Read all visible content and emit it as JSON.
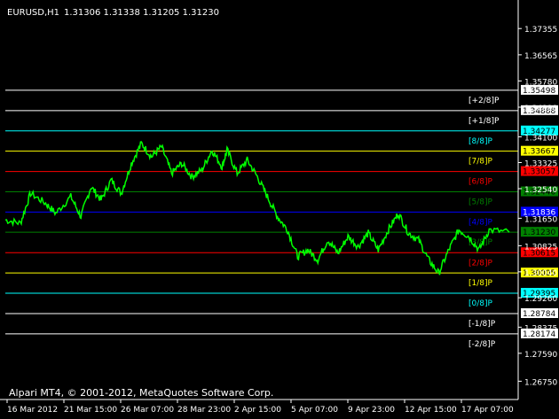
{
  "header": {
    "symbol_tf": "EURUSD,H1",
    "ohlc": "1.31306 1.31338 1.31205 1.31230"
  },
  "footer": {
    "copyright": "Alpari MT4, © 2001-2012, MetaQuotes Software Corp."
  },
  "colors": {
    "background": "#000000",
    "price_line": "#00ff00",
    "axis": "#ffffff"
  },
  "y_axis_labels": [
    "1.37355",
    "1.36565",
    "1.35780",
    "1.34990",
    "1.34100",
    "1.33325",
    "1.32540",
    "1.31650",
    "1.30825",
    "1.30040",
    "1.29260",
    "1.28375",
    "1.27590",
    "1.26750"
  ],
  "x_axis_labels": [
    "16 Mar 2012",
    "21 Mar 15:00",
    "26 Mar 07:00",
    "28 Mar 23:00",
    "2 Apr 15:00",
    "5 Apr 07:00",
    "9 Apr 23:00",
    "12 Apr 15:00",
    "17 Apr 07:00"
  ],
  "murrey_lines": [
    {
      "label": "[+2/8]P",
      "price": "1.35498",
      "color": "#ffffff",
      "tag_bg": "#ffffff",
      "tag_fg": "#000000"
    },
    {
      "label": "[+1/8]P",
      "price": "1.34888",
      "color": "#ffffff",
      "tag_bg": "#ffffff",
      "tag_fg": "#000000"
    },
    {
      "label": "[8/8]P",
      "price": "1.34277",
      "color": "#00ffff",
      "tag_bg": "#00ffff",
      "tag_fg": "#000000"
    },
    {
      "label": "[7/8]P",
      "price": "1.33667",
      "color": "#ffff00",
      "tag_bg": "#ffff00",
      "tag_fg": "#000000"
    },
    {
      "label": "[6/8]P",
      "price": "1.33057",
      "color": "#ff0000",
      "tag_bg": "#ff0000",
      "tag_fg": "#000000"
    },
    {
      "label": "[5/8]P",
      "price": "1.32446",
      "color": "#008000",
      "tag_bg": "#008000",
      "tag_fg": "#000000"
    },
    {
      "label": "[4/8]P",
      "price": "1.31836",
      "color": "#0000ff",
      "tag_bg": "#0000ff",
      "tag_fg": "#ffffff"
    },
    {
      "label": "[3/8]P",
      "price": "1.31230",
      "color": "#008000",
      "tag_bg": "#008000",
      "tag_fg": "#000000"
    },
    {
      "label": "[2/8]P",
      "price": "1.30615",
      "color": "#ff0000",
      "tag_bg": "#ff0000",
      "tag_fg": "#000000"
    },
    {
      "label": "[1/8]P",
      "price": "1.30005",
      "color": "#ffff00",
      "tag_bg": "#ffff00",
      "tag_fg": "#000000"
    },
    {
      "label": "[0/8]P",
      "price": "1.29395",
      "color": "#00ffff",
      "tag_bg": "#00ffff",
      "tag_fg": "#000000"
    },
    {
      "label": "[-1/8]P",
      "price": "1.28784",
      "color": "#ffffff",
      "tag_bg": "#ffffff",
      "tag_fg": "#000000"
    },
    {
      "label": "[-2/8]P",
      "price": "1.28174",
      "color": "#ffffff",
      "tag_bg": "#ffffff",
      "tag_fg": "#000000"
    }
  ],
  "price_path": [
    [
      0.0,
      1.316
    ],
    [
      0.03,
      1.315
    ],
    [
      0.05,
      1.324
    ],
    [
      0.08,
      1.321
    ],
    [
      0.1,
      1.318
    ],
    [
      0.13,
      1.323
    ],
    [
      0.15,
      1.317
    ],
    [
      0.17,
      1.326
    ],
    [
      0.19,
      1.322
    ],
    [
      0.21,
      1.328
    ],
    [
      0.23,
      1.324
    ],
    [
      0.25,
      1.333
    ],
    [
      0.27,
      1.339
    ],
    [
      0.29,
      1.335
    ],
    [
      0.31,
      1.338
    ],
    [
      0.33,
      1.33
    ],
    [
      0.35,
      1.333
    ],
    [
      0.37,
      1.329
    ],
    [
      0.39,
      1.331
    ],
    [
      0.41,
      1.337
    ],
    [
      0.43,
      1.332
    ],
    [
      0.44,
      1.337
    ],
    [
      0.46,
      1.33
    ],
    [
      0.48,
      1.334
    ],
    [
      0.5,
      1.329
    ],
    [
      0.52,
      1.323
    ],
    [
      0.54,
      1.317
    ],
    [
      0.56,
      1.313
    ],
    [
      0.58,
      1.305
    ],
    [
      0.6,
      1.307
    ],
    [
      0.62,
      1.304
    ],
    [
      0.64,
      1.31
    ],
    [
      0.66,
      1.306
    ],
    [
      0.68,
      1.311
    ],
    [
      0.7,
      1.308
    ],
    [
      0.72,
      1.312
    ],
    [
      0.74,
      1.307
    ],
    [
      0.76,
      1.313
    ],
    [
      0.78,
      1.318
    ],
    [
      0.8,
      1.312
    ],
    [
      0.82,
      1.31
    ],
    [
      0.84,
      1.304
    ],
    [
      0.86,
      1.3
    ],
    [
      0.88,
      1.307
    ],
    [
      0.9,
      1.313
    ],
    [
      0.92,
      1.311
    ],
    [
      0.94,
      1.307
    ],
    [
      0.96,
      1.313
    ],
    [
      1.0,
      1.3123
    ]
  ]
}
